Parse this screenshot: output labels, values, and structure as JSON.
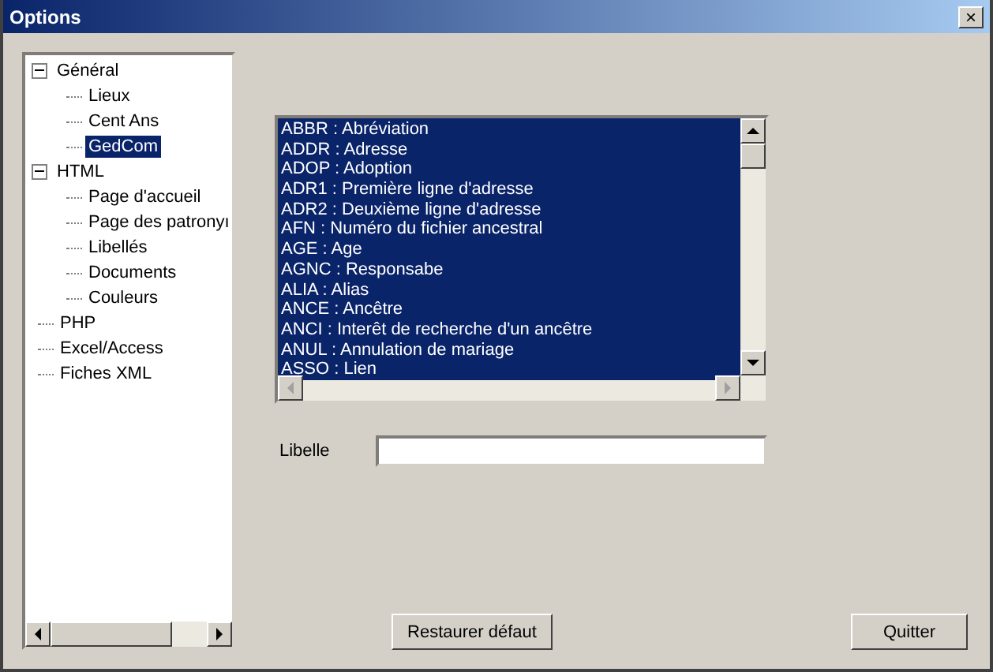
{
  "window": {
    "title": "Options",
    "close": "×"
  },
  "tree": [
    {
      "label": "Général",
      "expanded": true,
      "selected": false,
      "children": [
        {
          "label": "Lieux",
          "selected": false
        },
        {
          "label": "Cent Ans",
          "selected": false
        },
        {
          "label": "GedCom",
          "selected": true
        }
      ]
    },
    {
      "label": "HTML",
      "expanded": true,
      "selected": false,
      "children": [
        {
          "label": "Page d'accueil",
          "selected": false
        },
        {
          "label": "Page des patronyı",
          "selected": false
        },
        {
          "label": "Libellés",
          "selected": false
        },
        {
          "label": "Documents",
          "selected": false
        },
        {
          "label": "Couleurs",
          "selected": false
        }
      ]
    },
    {
      "label": "PHP",
      "selected": false
    },
    {
      "label": "Excel/Access",
      "selected": false
    },
    {
      "label": "Fiches XML",
      "selected": false
    }
  ],
  "tags": [
    {
      "label": "ABBR : Abréviation",
      "selected": true
    },
    {
      "label": "ADDR : Adresse",
      "selected": true
    },
    {
      "label": "ADOP : Adoption",
      "selected": true
    },
    {
      "label": "ADR1 : Première ligne d'adresse",
      "selected": true
    },
    {
      "label": "ADR2 : Deuxième ligne d'adresse",
      "selected": true
    },
    {
      "label": "AFN : Numéro du fichier ancestral",
      "selected": true
    },
    {
      "label": "AGE : Age",
      "selected": true
    },
    {
      "label": "AGNC : Responsabe",
      "selected": true
    },
    {
      "label": "ALIA : Alias",
      "selected": true
    },
    {
      "label": "ANCE : Ancêtre",
      "selected": true
    },
    {
      "label": "ANCI : Interêt de recherche d'un ancêtre",
      "selected": true
    },
    {
      "label": "ANUL : Annulation de mariage",
      "selected": true
    },
    {
      "label": "ASSO : Lien",
      "selected": true
    }
  ],
  "libelle": {
    "label": "Libelle"
  },
  "buttons": [
    {
      "label": "Restaurer défaut",
      "kind": "restore"
    },
    {
      "label": "Quitter",
      "kind": "quit"
    }
  ]
}
